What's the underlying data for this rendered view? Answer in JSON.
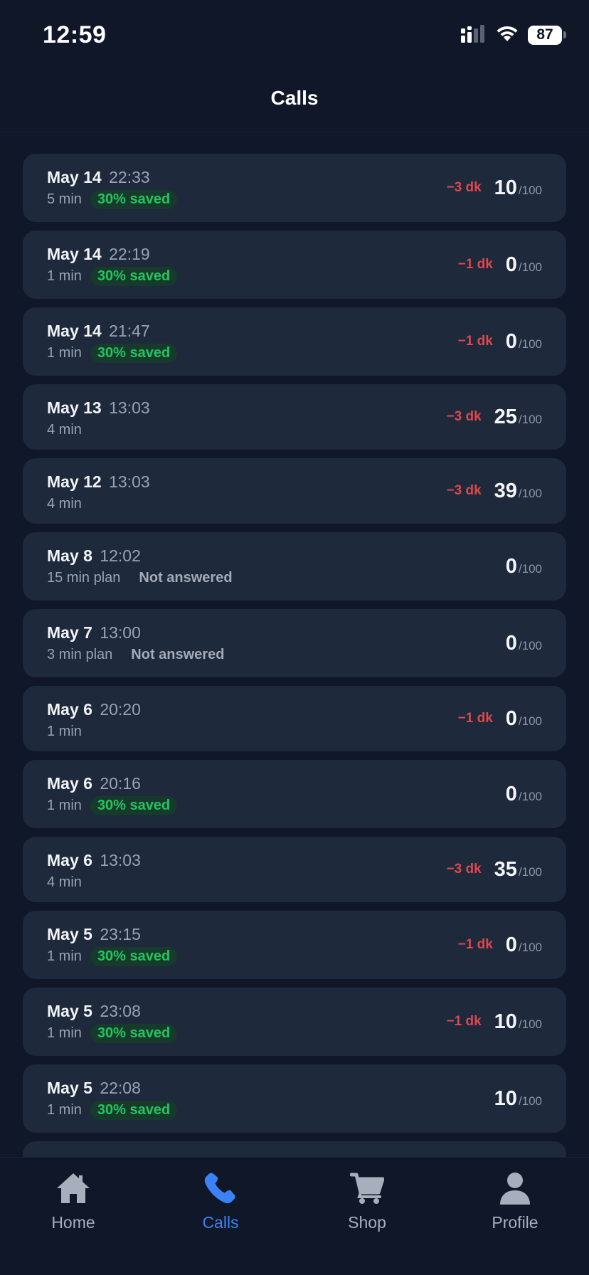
{
  "status_bar": {
    "time": "12:59",
    "battery": "87"
  },
  "header": {
    "title": "Calls"
  },
  "calls": [
    {
      "date": "May 14",
      "time": "22:33",
      "duration": "5 min",
      "badge": "30% saved",
      "delta": "−3 dk",
      "score": "10",
      "score_max": "/100"
    },
    {
      "date": "May 14",
      "time": "22:19",
      "duration": "1 min",
      "badge": "30% saved",
      "delta": "−1 dk",
      "score": "0",
      "score_max": "/100"
    },
    {
      "date": "May 14",
      "time": "21:47",
      "duration": "1 min",
      "badge": "30% saved",
      "delta": "−1 dk",
      "score": "0",
      "score_max": "/100"
    },
    {
      "date": "May 13",
      "time": "13:03",
      "duration": "4 min",
      "delta": "−3 dk",
      "score": "25",
      "score_max": "/100"
    },
    {
      "date": "May 12",
      "time": "13:03",
      "duration": "4 min",
      "delta": "−3 dk",
      "score": "39",
      "score_max": "/100"
    },
    {
      "date": "May 8",
      "time": "12:02",
      "duration": "15 min plan",
      "status": "Not answered",
      "score": "0",
      "score_max": "/100"
    },
    {
      "date": "May 7",
      "time": "13:00",
      "duration": "3 min plan",
      "status": "Not answered",
      "score": "0",
      "score_max": "/100"
    },
    {
      "date": "May 6",
      "time": "20:20",
      "duration": "1 min",
      "delta": "−1 dk",
      "score": "0",
      "score_max": "/100"
    },
    {
      "date": "May 6",
      "time": "20:16",
      "duration": "1 min",
      "badge": "30% saved",
      "score": "0",
      "score_max": "/100"
    },
    {
      "date": "May 6",
      "time": "13:03",
      "duration": "4 min",
      "delta": "−3 dk",
      "score": "35",
      "score_max": "/100"
    },
    {
      "date": "May 5",
      "time": "23:15",
      "duration": "1 min",
      "badge": "30% saved",
      "delta": "−1 dk",
      "score": "0",
      "score_max": "/100"
    },
    {
      "date": "May 5",
      "time": "23:08",
      "duration": "1 min",
      "badge": "30% saved",
      "delta": "−1 dk",
      "score": "10",
      "score_max": "/100"
    },
    {
      "date": "May 5",
      "time": "22:08",
      "duration": "1 min",
      "badge": "30% saved",
      "score": "10",
      "score_max": "/100"
    }
  ],
  "tab_bar": {
    "tabs": [
      {
        "label": "Home",
        "icon": "home-icon",
        "active": false
      },
      {
        "label": "Calls",
        "icon": "phone-icon",
        "active": true
      },
      {
        "label": "Shop",
        "icon": "cart-icon",
        "active": false
      },
      {
        "label": "Profile",
        "icon": "user-icon",
        "active": false
      }
    ]
  },
  "colors": {
    "background": "#0f1729",
    "card": "#1e293b",
    "accent": "#3b82f6",
    "saved": "#22c55e",
    "negative": "#e0474c"
  }
}
